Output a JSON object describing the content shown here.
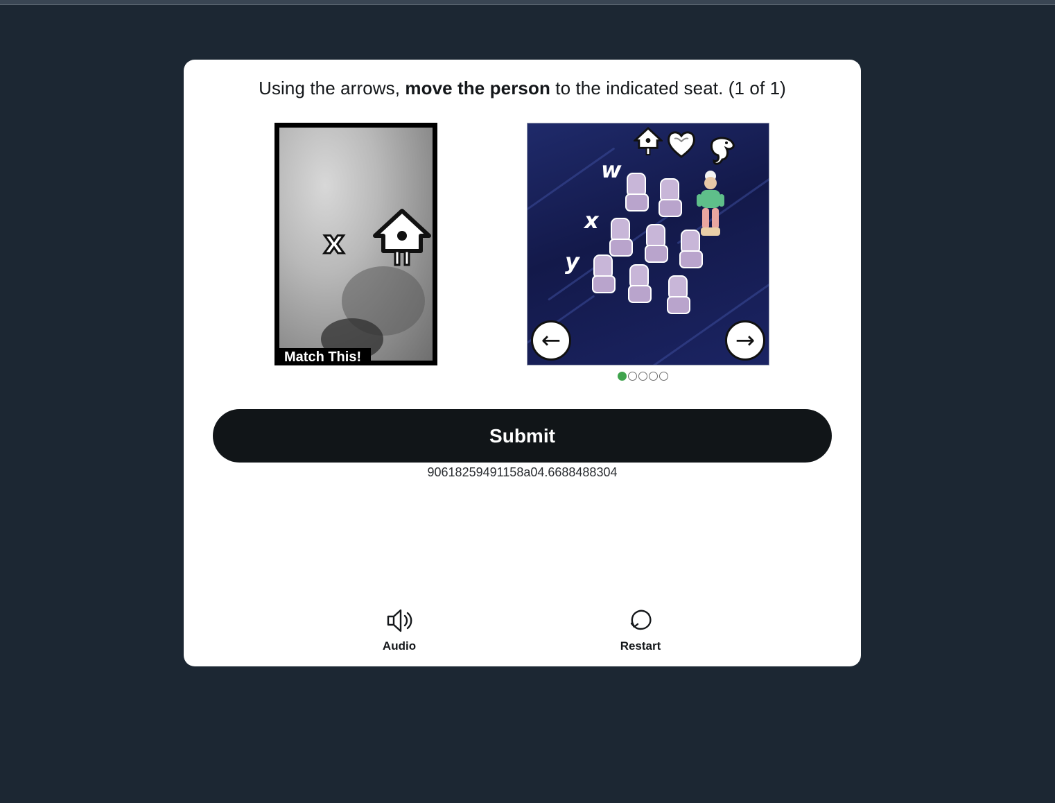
{
  "instruction": {
    "pre": "Using the arrows, ",
    "bold": "move the person",
    "post": " to the indicated seat. (1 of 1)"
  },
  "reference": {
    "label": "Match This!",
    "row_letter": "x",
    "icon": "birdhouse-icon"
  },
  "game": {
    "row_labels": [
      "w",
      "x",
      "y"
    ],
    "top_icons": [
      "birdhouse-icon",
      "heart-icon",
      "seahorse-icon"
    ],
    "left_arrow": "←",
    "right_arrow": "→",
    "page_indicator": {
      "current": 1,
      "total": 5
    }
  },
  "submit": {
    "label": "Submit"
  },
  "session_id": "90618259491158a04.6688488304",
  "tools": {
    "audio_label": "Audio",
    "restart_label": "Restart"
  }
}
